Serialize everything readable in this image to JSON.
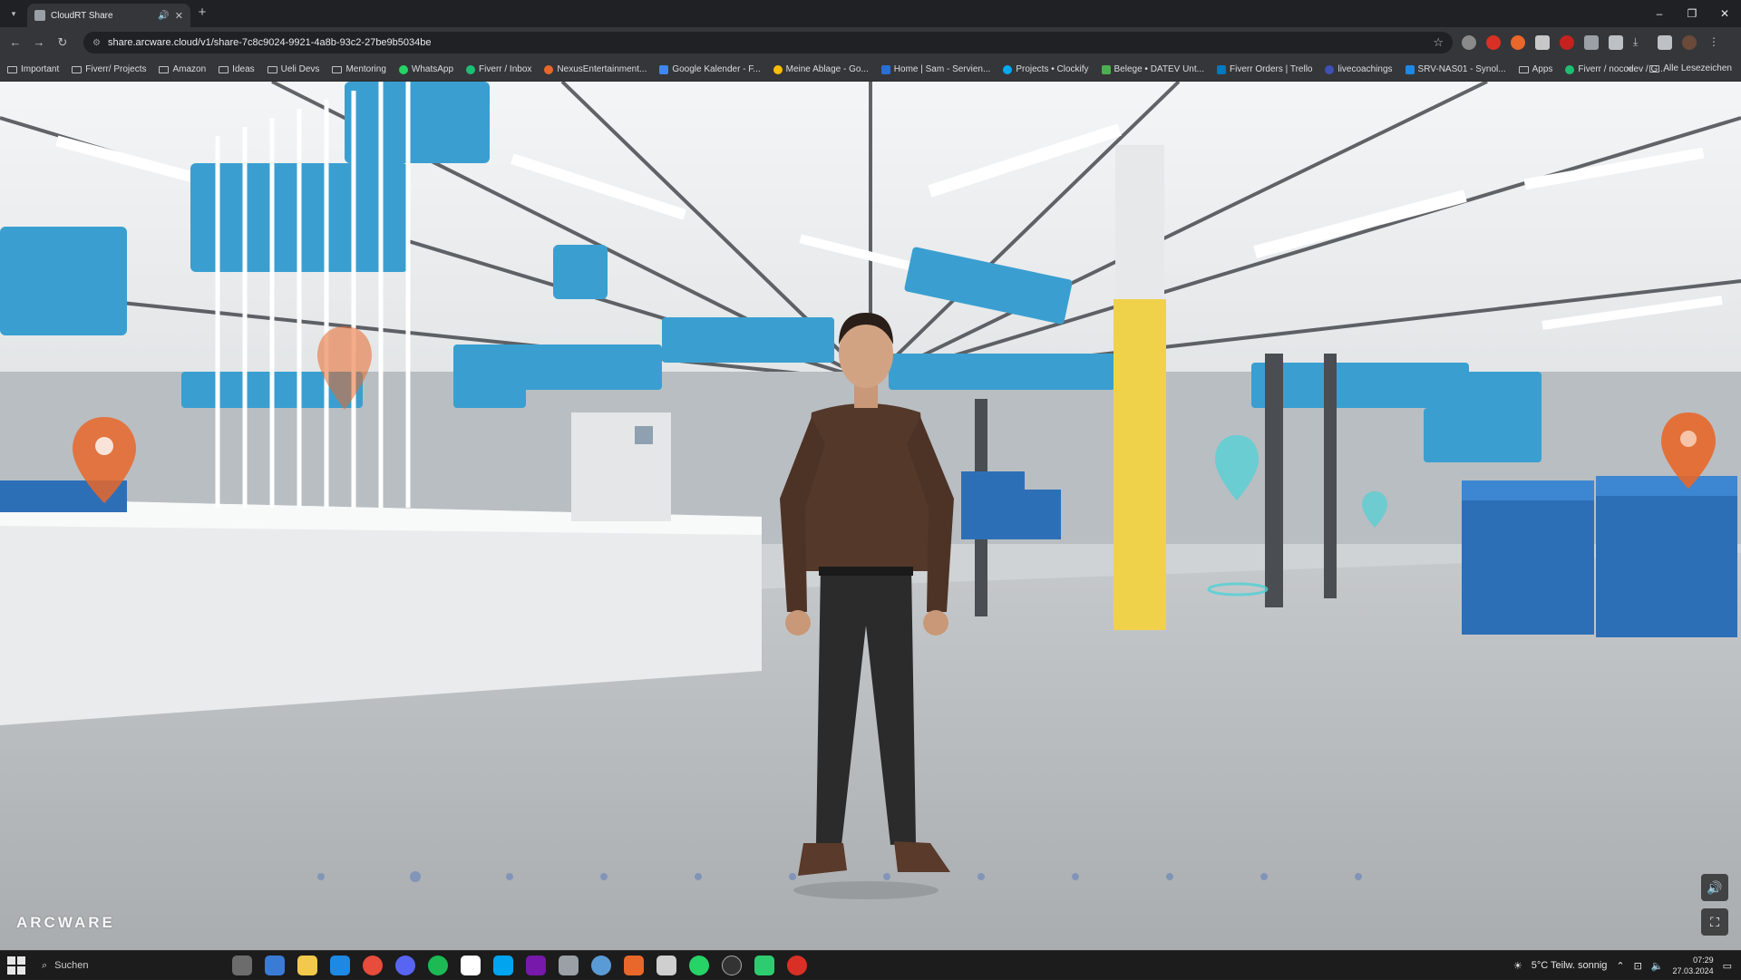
{
  "browser": {
    "tab_title": "CloudRT Share",
    "url": "share.arcware.cloud/v1/share-7c8c9024-9921-4a8b-93c2-27be9b5034be",
    "window_controls": {
      "minimize": "–",
      "maximize": "❐",
      "close": "✕"
    }
  },
  "bookmarks": [
    {
      "label": "Important",
      "icon": "folder-icon"
    },
    {
      "label": "Fiverr/ Projects",
      "icon": "folder-icon"
    },
    {
      "label": "Amazon",
      "icon": "folder-icon"
    },
    {
      "label": "Ideas",
      "icon": "folder-icon"
    },
    {
      "label": "Ueli Devs",
      "icon": "folder-icon"
    },
    {
      "label": "Mentoring",
      "icon": "folder-icon"
    },
    {
      "label": "WhatsApp",
      "icon": "whatsapp-icon"
    },
    {
      "label": "Fiverr / Inbox",
      "icon": "fiverr-icon"
    },
    {
      "label": "NexusEntertainment...",
      "icon": "site-icon"
    },
    {
      "label": "Google Kalender - F...",
      "icon": "calendar-icon"
    },
    {
      "label": "Meine Ablage - Go...",
      "icon": "drive-icon"
    },
    {
      "label": "Home | Sam - Servien...",
      "icon": "site-icon"
    },
    {
      "label": "Projects • Clockify",
      "icon": "clockify-icon"
    },
    {
      "label": "Belege • DATEV Unt...",
      "icon": "datev-icon"
    },
    {
      "label": "Fiverr Orders | Trello",
      "icon": "trello-icon"
    },
    {
      "label": "livecoachings",
      "icon": "site-icon"
    },
    {
      "label": "SRV-NAS01 - Synol...",
      "icon": "synology-icon"
    },
    {
      "label": "Apps",
      "icon": "folder-icon"
    },
    {
      "label": "Fiverr / nocodev / G...",
      "icon": "fiverr-icon"
    }
  ],
  "bookmarks_all": "Alle Lesezeichen",
  "viewport": {
    "brand": "ARCWARE",
    "volume_icon": "speaker-icon",
    "fullscreen_icon": "fullscreen-icon"
  },
  "taskbar": {
    "search_placeholder": "Suchen",
    "weather": "5°C  Teilw. sonnig",
    "time": "07:29",
    "date": "27.03.2024"
  },
  "colors": {
    "accent_blue": "#3a9fd0",
    "bin_blue": "#2d6fb7",
    "marker_orange": "#e8672a",
    "marker_cyan": "#4fd1d6",
    "pillar_yellow": "#f0d24a"
  }
}
